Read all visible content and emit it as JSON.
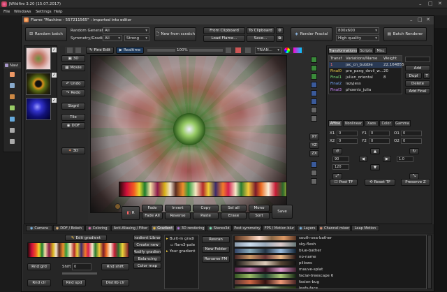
{
  "outer": {
    "title": "JWildfire 3.20 (15.07.2017)",
    "menu": [
      "File",
      "Windows",
      "Settings",
      "Help"
    ]
  },
  "bg_window": {
    "title": "Navi",
    "rows": [
      "",
      "",
      "",
      "",
      "",
      "",
      ""
    ]
  },
  "editor": {
    "title": "Flame \"Machine - 557211565\" : imported into editor",
    "random_batch": "Random batch",
    "random_generator_label": "Random Generator",
    "random_generator_value": "All",
    "symmetry_label": "Symmetry/Gradient",
    "symmetry_value": "All",
    "symmetry_strength": "Strong",
    "new_from_scratch": "New from scratch",
    "from_clipboard": "From Clipboard",
    "load_flame": "Load Flame...",
    "to_clipboard": "To Clipboard",
    "save": "Save...",
    "render_fractal": "Render Fractal",
    "resolution": "800x600",
    "quality": "High quality",
    "batch_renderer": "Batch Renderer"
  },
  "left_tools": {
    "items": [
      "3D",
      "Movie",
      "Undo",
      "Redo",
      "Sbgnl",
      "Tile",
      "DOF",
      "3D"
    ]
  },
  "preview_toolbar": {
    "fine_edit": "Fine Edit",
    "realtime": "Realtime",
    "zoom": "100%",
    "triangle_mode": "TRIAN..."
  },
  "bottom_buttons": {
    "row1": [
      "R",
      "Fade",
      "Invert",
      "Copy",
      "Sel all",
      "Mono",
      "Save"
    ],
    "row2": [
      "Fade All",
      "Reverse",
      "Paste",
      "Erase",
      "Sort"
    ]
  },
  "right_panel": {
    "tabs": [
      "Transformations",
      "Scripts",
      "Misc"
    ],
    "table_headers": [
      "Transf",
      "Variations/Name",
      "Weight"
    ],
    "rows": [
      {
        "transf": "1",
        "name": "jac_cn_bubble",
        "weight": "22.164855"
      },
      {
        "transf": "Final0",
        "name": "pre_pang_devil_w...",
        "weight": "20"
      },
      {
        "transf": "Final1",
        "name": "julian_oriental",
        "weight": "8"
      },
      {
        "transf": "Final2",
        "name": "lazyjess",
        "weight": ""
      },
      {
        "transf": "Final3",
        "name": "phoenix_julia",
        "weight": ""
      }
    ],
    "side_buttons": [
      "Add",
      "Dupl",
      "T",
      "Delete",
      "Add Final"
    ],
    "affine_tabs": [
      "Affine",
      "Nonlinear",
      "Xaos",
      "Color",
      "Gamma"
    ],
    "coord_labels": [
      "X1",
      "Y1",
      "O1",
      "X2",
      "Y2",
      "O2"
    ],
    "coord_values": [
      "0",
      "0",
      "0",
      "0",
      "0",
      "0"
    ],
    "xy_buttons": [
      "XY",
      "YZ",
      "ZX"
    ],
    "spinner_values": [
      "90",
      "120",
      "1.0"
    ],
    "post_tf": "Post TF",
    "reset_tf": "Reset TF",
    "preserve_z": "Preserve Z"
  },
  "bottom_tabs": [
    "Camera",
    "DOF / Bokeh",
    "Coloring",
    "Anti-Aliasing / Filter",
    "Gradient",
    "3D rendering",
    "Stereo3d",
    "Post symmetry",
    "FPS / Motion blur",
    "Layers",
    "Channel mixer",
    "Leap Motion"
  ],
  "gradient_panel": {
    "edit_gradient": "Edit gradient",
    "rnd_grd": "Rnd grd",
    "shift_label": "Shift",
    "shift_value": "0",
    "rnd_shift": "Rnd shift",
    "rnd_clr": "Rnd clr",
    "rnd_spd": "Rnd spd",
    "distrib_clr": "Distrib clr",
    "gradient_library": "Gradient Library",
    "create_new": "Create new",
    "modify_gradient": "Modify gradient",
    "balancing": "Balancing",
    "color_map": "Color map",
    "tree": [
      "Built-in gradi",
      "flam3-pale",
      "Your gradient"
    ],
    "rescan": "Rescan",
    "new_folder": "New Folder",
    "rename_fm": "Rename FM",
    "gradient_names": [
      "south-sea-bather",
      "sky-flesh",
      "blue-bather",
      "no-name",
      "pillows",
      "mauve-splat",
      "facial-treescape 6",
      "fasion-bug",
      "leafy-face"
    ]
  }
}
